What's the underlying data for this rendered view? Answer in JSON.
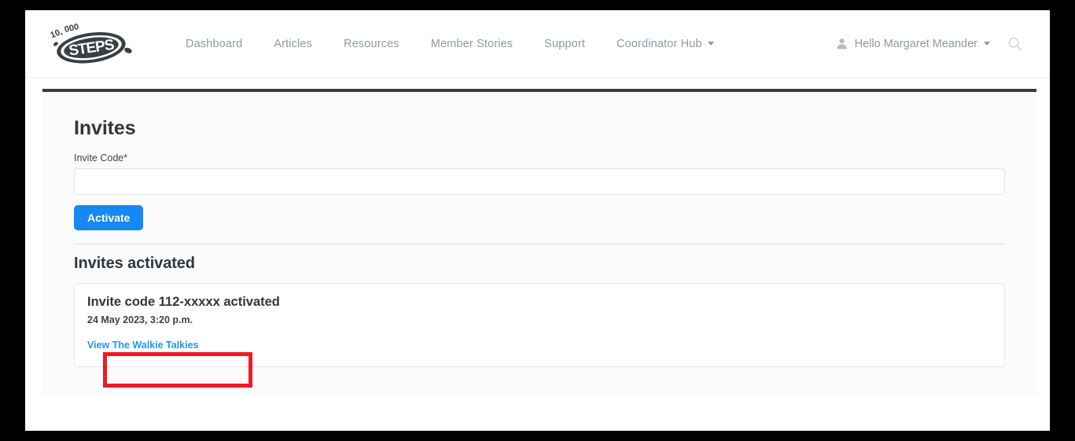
{
  "brand": {
    "name": "10,000 STEPS",
    "line1": "10,000",
    "line2": "STEPS"
  },
  "nav": {
    "items": [
      {
        "label": "Dashboard",
        "has_caret": false
      },
      {
        "label": "Articles",
        "has_caret": false
      },
      {
        "label": "Resources",
        "has_caret": false
      },
      {
        "label": "Member Stories",
        "has_caret": false
      },
      {
        "label": "Support",
        "has_caret": false
      },
      {
        "label": "Coordinator Hub",
        "has_caret": true
      }
    ],
    "user_greeting": "Hello Margaret Meander",
    "user_icon": "user-icon",
    "search_icon": "search-icon",
    "caret_icon": "chevron-down-icon"
  },
  "main": {
    "page_title": "Invites",
    "invite_code_label": "Invite Code*",
    "invite_code_value": "",
    "invite_code_placeholder": "",
    "activate_button": "Activate",
    "section_title": "Invites activated",
    "invites": [
      {
        "title": "Invite code 112-xxxxx  activated",
        "timestamp": "24 May 2023, 3:20 p.m.",
        "link_label": "View The Walkie Talkies"
      }
    ]
  },
  "colors": {
    "primary_button": "#1588f5",
    "link": "#2196f3",
    "panel_top_bar": "#333c47",
    "annotation": "#ee1b24",
    "nav_text": "#8d9aa5",
    "heading": "#2f3740"
  }
}
